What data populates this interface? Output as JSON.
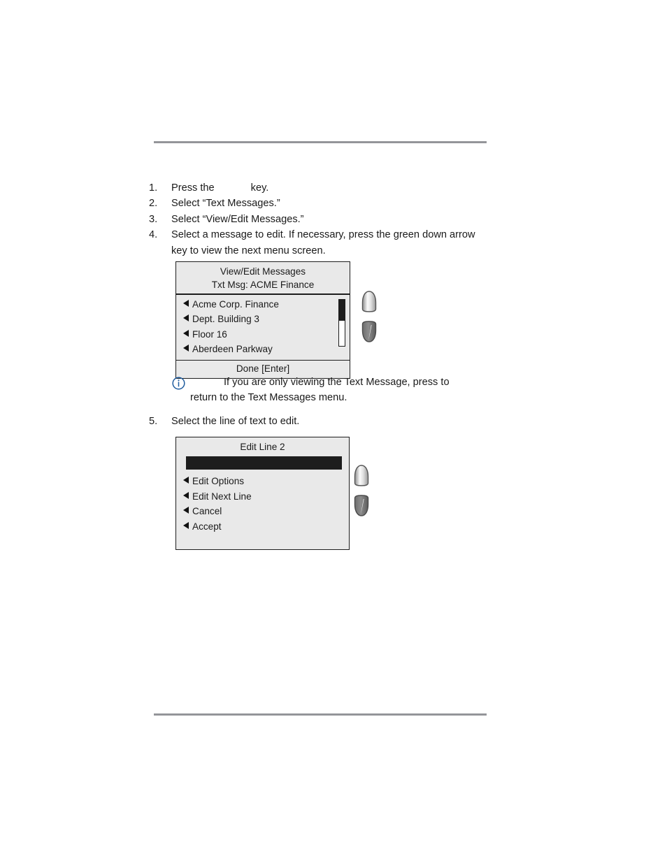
{
  "steps": [
    {
      "num": "1.",
      "text_before": "Press the",
      "text_after": "key.",
      "has_key_gap": true
    },
    {
      "num": "2.",
      "text_before": "Select “Text Messages.”",
      "text_after": "",
      "has_key_gap": false
    },
    {
      "num": "3.",
      "text_before": "Select “View/Edit Messages.”",
      "text_after": "",
      "has_key_gap": false
    },
    {
      "num": "4.",
      "text_before": "Select a message to edit. If necessary, press the green down arrow key to view the next menu screen.",
      "text_after": "",
      "has_key_gap": false
    },
    {
      "num": "5.",
      "text_before": "Select the line of text to edit.",
      "text_after": "",
      "has_key_gap": false
    }
  ],
  "screen1": {
    "title_line1": "View/Edit Messages",
    "title_line2": "Txt Msg:  ACME Finance",
    "items": [
      "Acme Corp. Finance",
      "Dept. Building 3",
      "Floor 16",
      "Aberdeen Parkway"
    ],
    "footer": "Done [Enter]",
    "scrollbar": {
      "thumb_position": "top"
    },
    "navkeys": [
      "up-arrow-key",
      "down-arrow-key"
    ]
  },
  "screen2": {
    "title": "Edit Line 2",
    "edit_field_value": "",
    "items": [
      "Edit Options",
      "Edit Next Line",
      "Cancel",
      "Accept"
    ],
    "navkeys": [
      "up-arrow-key",
      "down-arrow-key"
    ]
  },
  "note": {
    "icon": "info-icon",
    "line1": "If you are only viewing the Text Message, press",
    "line2": "to return to the Text Messages menu."
  },
  "colors": {
    "rule": "#949599",
    "lcd_background": "#e9e9e9",
    "lcd_border": "#1d1d1d",
    "note_icon": "#1f5c9e",
    "highlight_bar": "#1d1d1d"
  }
}
